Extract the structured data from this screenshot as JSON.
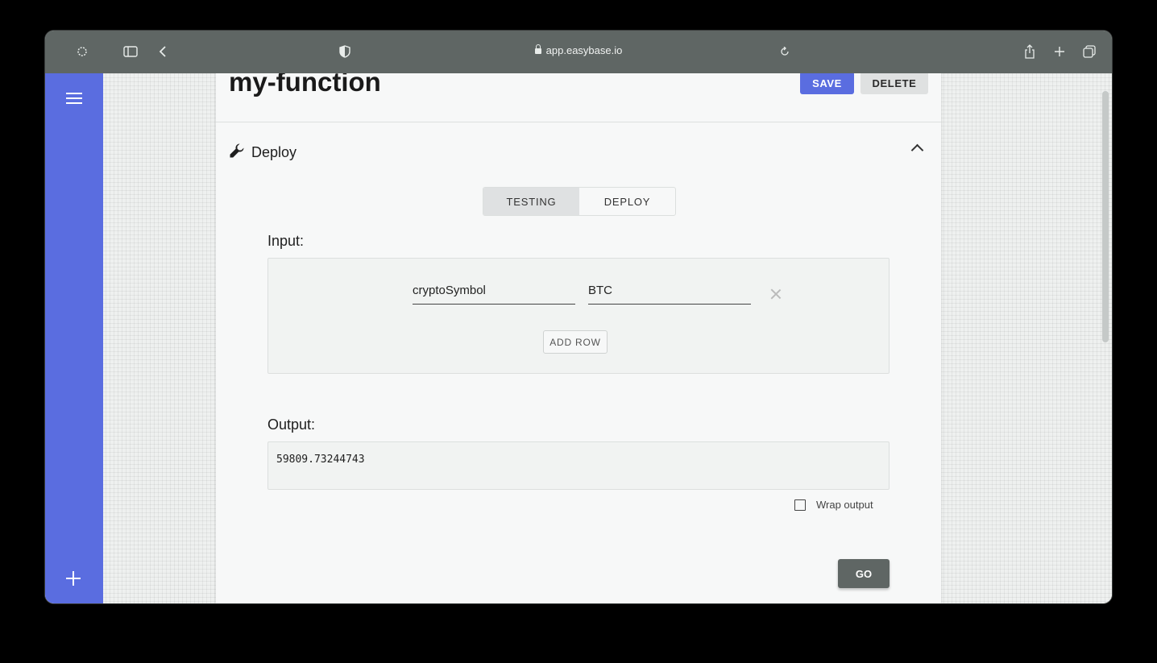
{
  "browser": {
    "url": "app.easybase.io"
  },
  "page": {
    "title": "my-function",
    "save_label": "SAVE",
    "delete_label": "DELETE"
  },
  "deploy_section": {
    "heading": "Deploy",
    "tabs": [
      {
        "label": "TESTING",
        "active": true
      },
      {
        "label": "DEPLOY",
        "active": false
      }
    ]
  },
  "input_section": {
    "label": "Input:",
    "rows": [
      {
        "key": "cryptoSymbol",
        "value": "BTC"
      }
    ],
    "add_row_label": "ADD ROW"
  },
  "output_section": {
    "label": "Output:",
    "value": "59809.73244743",
    "wrap_output_label": "Wrap output",
    "wrap_output_checked": false
  },
  "go_label": "GO",
  "colors": {
    "accent": "#5a6de0",
    "toolbar": "#5f6664",
    "go_button": "#5f6664"
  }
}
